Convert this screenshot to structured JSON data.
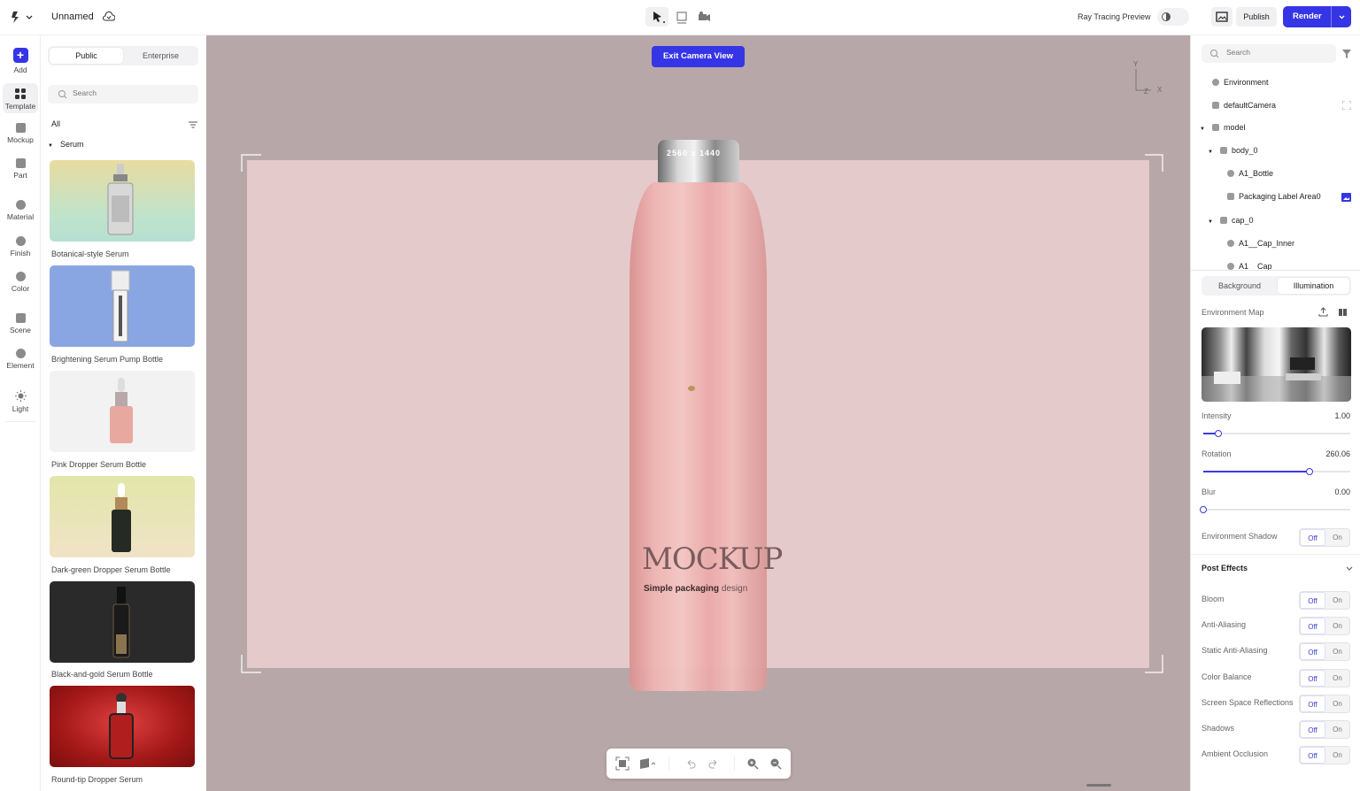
{
  "header": {
    "doc_title": "Unnamed",
    "ray_tracing_label": "Ray Tracing Preview",
    "publish_label": "Publish",
    "render_label": "Render"
  },
  "rail": {
    "items": [
      {
        "label": "Add",
        "icon": "plus-icon"
      },
      {
        "label": "Template",
        "icon": "grid-icon"
      },
      {
        "label": "Mockup",
        "icon": "cube-icon"
      },
      {
        "label": "Part",
        "icon": "layers-icon"
      },
      {
        "label": "Material",
        "icon": "sphere-icon"
      },
      {
        "label": "Finish",
        "icon": "finish-icon"
      },
      {
        "label": "Color",
        "icon": "palette-icon"
      },
      {
        "label": "Scene",
        "icon": "image-icon"
      },
      {
        "label": "Element",
        "icon": "element-icon"
      },
      {
        "label": "Light",
        "icon": "sun-icon"
      }
    ]
  },
  "library": {
    "tabs": [
      "Public",
      "Enterprise"
    ],
    "search_placeholder": "Search",
    "filter_label": "All",
    "category": "Serum",
    "templates": [
      {
        "name": "Botanical-style Serum"
      },
      {
        "name": "Brightening Serum Pump Bottle"
      },
      {
        "name": "Pink Dropper Serum Bottle"
      },
      {
        "name": "Dark-green Dropper Serum Bottle"
      },
      {
        "name": "Black-and-gold Serum Bottle"
      },
      {
        "name": "Round-tip Dropper Serum"
      }
    ]
  },
  "canvas": {
    "exit_camera_label": "Exit Camera View",
    "axes": {
      "y": "Y",
      "z": "Z",
      "x": "X"
    },
    "resolution_text": "2560 x 1440",
    "label_brand": "MOCKUP",
    "label_tagline_bold": "Simple packaging",
    "label_tagline_light": "design"
  },
  "right_panel": {
    "search_placeholder": "Search",
    "tree": [
      {
        "label": "Environment"
      },
      {
        "label": "defaultCamera"
      },
      {
        "label": "model"
      },
      {
        "label": "body_0"
      },
      {
        "label": "A1_Bottle"
      },
      {
        "label": "Packaging Label Area0"
      },
      {
        "label": "cap_0"
      },
      {
        "label": "A1__Cap_Inner"
      },
      {
        "label": "A1__Cap"
      }
    ],
    "tabs": [
      "Background",
      "Illumination"
    ],
    "environment_map_label": "Environment Map",
    "intensity": {
      "label": "Intensity",
      "value": "1.00",
      "fraction": 0.1
    },
    "rotation": {
      "label": "Rotation",
      "value": "260.06",
      "fraction": 0.72
    },
    "blur": {
      "label": "Blur",
      "value": "0.00",
      "fraction": 0.0
    },
    "environment_shadow_label": "Environment Shadow",
    "post_effects_label": "Post Effects",
    "off_label": "Off",
    "on_label": "On",
    "effects": [
      {
        "label": "Bloom"
      },
      {
        "label": "Anti-Aliasing"
      },
      {
        "label": "Static Anti-Aliasing"
      },
      {
        "label": "Color Balance"
      },
      {
        "label": "Screen Space Reflections"
      },
      {
        "label": "Shadows"
      },
      {
        "label": "Ambient Occlusion"
      }
    ]
  },
  "colors": {
    "accent": "#3535e6",
    "canvas_bg": "#b8a7a8",
    "frame": "#e6cccc",
    "bottle": "#e8a9ab"
  }
}
